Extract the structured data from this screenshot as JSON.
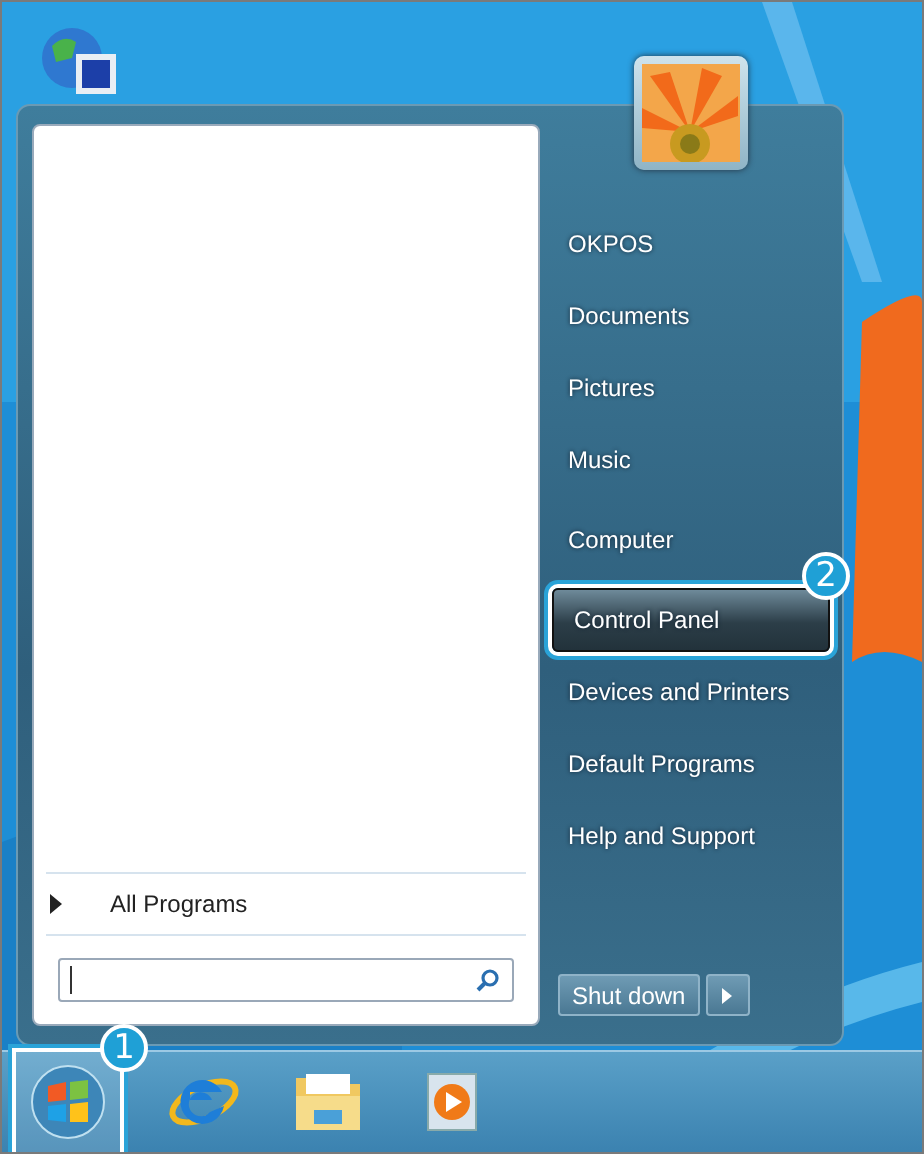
{
  "start_menu": {
    "all_programs": "All Programs",
    "right_items": [
      {
        "label": "OKPOS",
        "selected": false
      },
      {
        "label": "Documents",
        "selected": false
      },
      {
        "label": "Pictures",
        "selected": false
      },
      {
        "label": "Music",
        "selected": false
      },
      {
        "label": "Computer",
        "selected": false
      },
      {
        "label": "Control Panel",
        "selected": true,
        "callout": "2"
      },
      {
        "label": "Devices and Printers",
        "selected": false
      },
      {
        "label": "Default Programs",
        "selected": false
      },
      {
        "label": "Help and Support",
        "selected": false
      }
    ],
    "shut_down": "Shut down"
  },
  "taskbar": {
    "start_button": {
      "callout": "1"
    },
    "pinned": [
      {
        "kind": "browser"
      },
      {
        "kind": "folder"
      },
      {
        "kind": "media"
      }
    ]
  }
}
